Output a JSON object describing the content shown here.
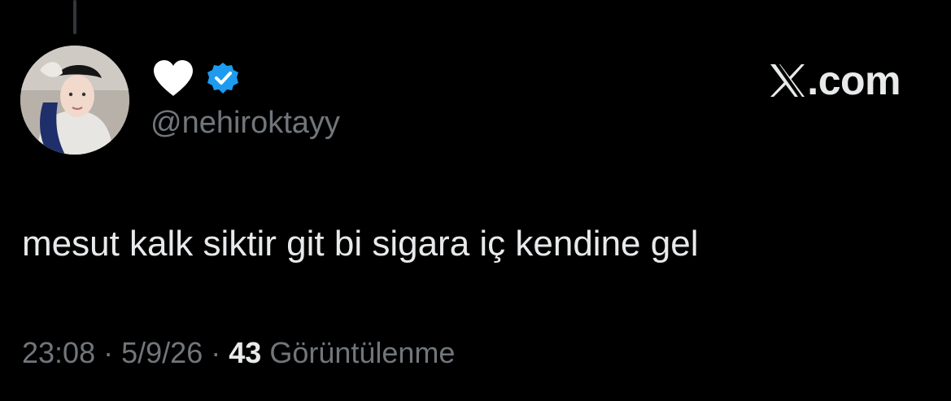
{
  "author": {
    "display_name_icon": "white-heart-icon",
    "verified_icon": "verified-badge-icon",
    "handle": "@nehiroktayy",
    "avatar": "profile-photo"
  },
  "brand": {
    "icon": "x-logo-icon",
    "domain": ".com"
  },
  "tweet": {
    "text": "mesut kalk siktir git bi sigara iç kendine gel"
  },
  "meta": {
    "time": "23:08",
    "separator_1": "·",
    "date": "5/9/26",
    "separator_2": "·",
    "views_count": "43",
    "views_label": "Görüntülenme"
  },
  "colors": {
    "background": "#000000",
    "primary_text": "#e7e9ea",
    "secondary_text": "#71767b",
    "verified_blue": "#1d9bf0"
  }
}
